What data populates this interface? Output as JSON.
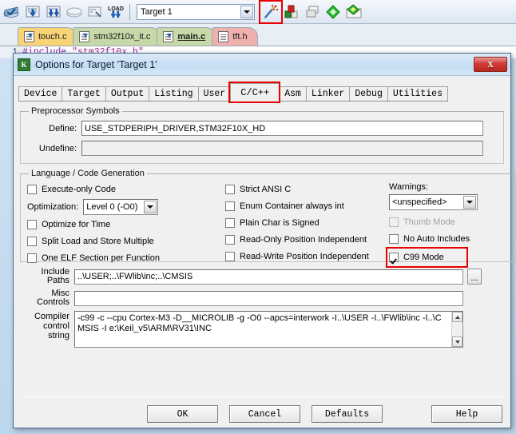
{
  "ide": {
    "toolbar": {
      "icons": [
        {
          "name": "translate-file-icon",
          "glyph": "build-translate"
        },
        {
          "name": "build-target-icon",
          "glyph": "build-down"
        },
        {
          "name": "rebuild-all-icon",
          "glyph": "build-down-double"
        },
        {
          "name": "batch-build-icon",
          "glyph": "stack"
        },
        {
          "name": "stop-build-icon",
          "glyph": "stop-build"
        },
        {
          "name": "download-to-flash-icon",
          "glyph": "load"
        }
      ],
      "target_select_value": "Target 1",
      "right_icons": [
        {
          "name": "options-for-target-icon",
          "glyph": "magic-wand",
          "highlighted": true
        },
        {
          "name": "manage-project-items-icon",
          "glyph": "components"
        },
        {
          "name": "manage-multi-project-icon",
          "glyph": "windows"
        },
        {
          "name": "configuration-wizard-icon",
          "glyph": "diamond-green"
        },
        {
          "name": "open-build-output-icon",
          "glyph": "diamond-folder"
        }
      ]
    },
    "file_tabs": [
      {
        "label": "touch.c",
        "color": "yellow",
        "active": false
      },
      {
        "label": "stm32f10x_it.c",
        "color": "green",
        "active": false
      },
      {
        "label": "main.c",
        "color": "green",
        "active": true
      },
      {
        "label": "tft.h",
        "color": "pink",
        "active": false
      }
    ],
    "editor": {
      "line_number": "1",
      "code_include": "#include",
      "code_header": "\"stm32f10x.h\""
    }
  },
  "dialog": {
    "title": "Options for Target 'Target 1'",
    "icon_label": "K",
    "close_label": "X",
    "tabs": [
      {
        "label": "Device",
        "selected": false,
        "highlighted": false
      },
      {
        "label": "Target",
        "selected": false,
        "highlighted": false
      },
      {
        "label": "Output",
        "selected": false,
        "highlighted": false
      },
      {
        "label": "Listing",
        "selected": false,
        "highlighted": false
      },
      {
        "label": "User",
        "selected": false,
        "highlighted": false
      },
      {
        "label": "C/C++",
        "selected": true,
        "highlighted": true
      },
      {
        "label": "Asm",
        "selected": false,
        "highlighted": false
      },
      {
        "label": "Linker",
        "selected": false,
        "highlighted": false
      },
      {
        "label": "Debug",
        "selected": false,
        "highlighted": false
      },
      {
        "label": "Utilities",
        "selected": false,
        "highlighted": false
      }
    ],
    "preprocessor": {
      "legend": "Preprocessor Symbols",
      "define_label": "Define:",
      "define_value": "USE_STDPERIPH_DRIVER,STM32F10X_HD",
      "undefine_label": "Undefine:",
      "undefine_value": ""
    },
    "language": {
      "legend": "Language / Code Generation",
      "left_checks": [
        {
          "label": "Execute-only Code",
          "checked": false,
          "disabled": false
        },
        {
          "label": "Optimize for Time",
          "checked": false,
          "disabled": false
        },
        {
          "label": "Split Load and Store Multiple",
          "checked": false,
          "disabled": false
        },
        {
          "label": "One ELF Section per Function",
          "checked": false,
          "disabled": false
        }
      ],
      "optimization_label": "Optimization:",
      "optimization_value": "Level 0 (-O0)",
      "mid_checks": [
        {
          "label": "Strict ANSI C",
          "checked": false,
          "disabled": false
        },
        {
          "label": "Enum Container always int",
          "checked": false,
          "disabled": false
        },
        {
          "label": "Plain Char is Signed",
          "checked": false,
          "disabled": false
        },
        {
          "label": "Read-Only Position Independent",
          "checked": false,
          "disabled": false
        },
        {
          "label": "Read-Write Position Independent",
          "checked": false,
          "disabled": false
        }
      ],
      "warnings_label": "Warnings:",
      "warnings_value": "<unspecified>",
      "right_checks": [
        {
          "label": "Thumb Mode",
          "checked": false,
          "disabled": true,
          "highlighted": false
        },
        {
          "label": "No Auto Includes",
          "checked": false,
          "disabled": false,
          "highlighted": false
        },
        {
          "label": "C99 Mode",
          "checked": true,
          "disabled": false,
          "highlighted": true
        }
      ]
    },
    "paths": {
      "include_label_1": "Include",
      "include_label_2": "Paths",
      "include_value": "..\\USER;..\\FWlib\\inc;..\\CMSIS",
      "browse_label": "...",
      "misc_label_1": "Misc",
      "misc_label_2": "Controls",
      "misc_value": "",
      "compiler_label_1": "Compiler",
      "compiler_label_2": "control",
      "compiler_label_3": "string",
      "compiler_value": "-c99 -c --cpu Cortex-M3 -D__MICROLIB -g -O0 --apcs=interwork -I..\\USER -I..\\FWlib\\inc -I..\\CMSIS -I e:\\Keil_v5\\ARM\\RV31\\INC"
    },
    "footer_buttons": [
      {
        "label": "OK",
        "name": "ok-button"
      },
      {
        "label": "Cancel",
        "name": "cancel-button"
      },
      {
        "label": "Defaults",
        "name": "defaults-button"
      },
      {
        "label": "Help",
        "name": "help-button"
      }
    ]
  },
  "colors": {
    "highlight_red": "#e60000",
    "tab_yellow": "#f8d477",
    "tab_green": "#c7d9a8",
    "tab_pink": "#efb0ae",
    "dialog_bg": "#f0f0f0",
    "title_blue": "#c3ddf2"
  }
}
